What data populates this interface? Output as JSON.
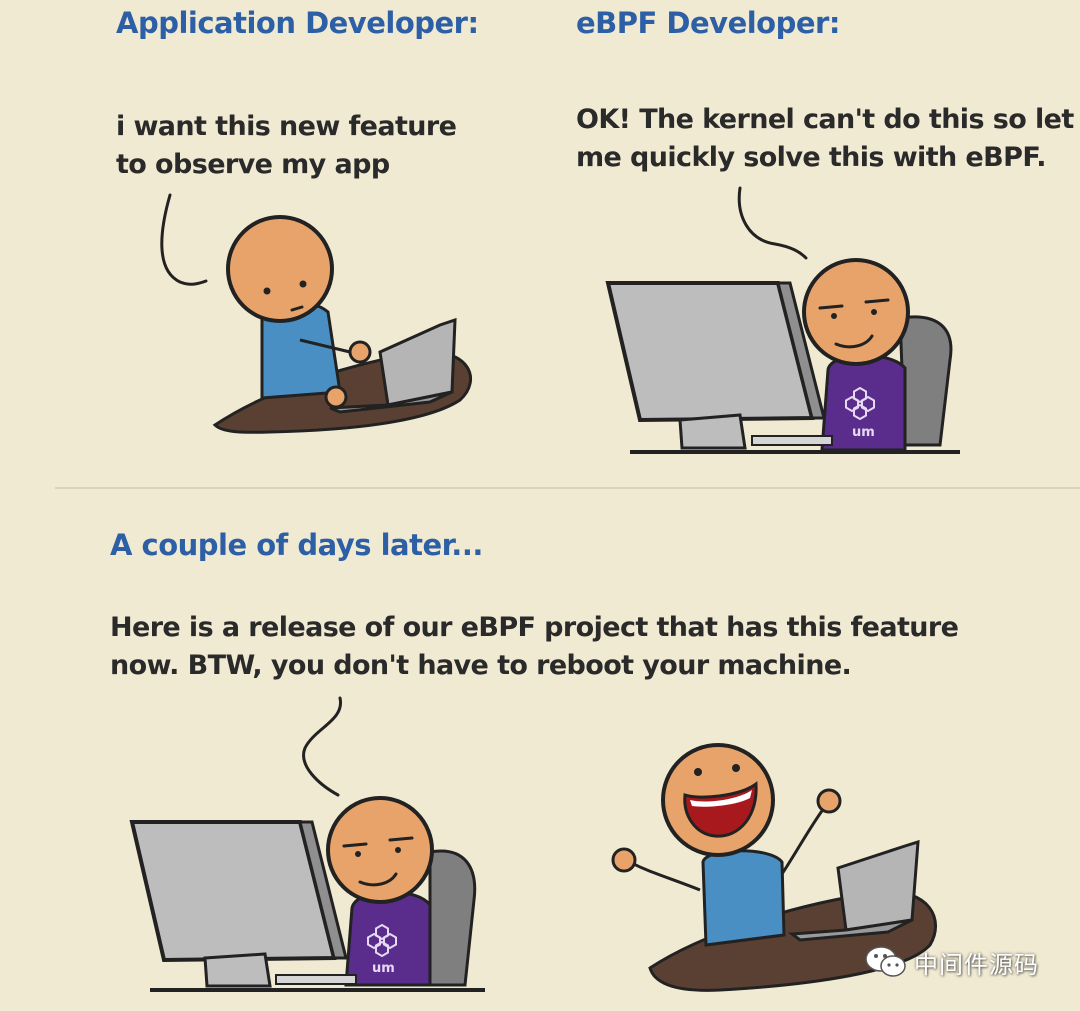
{
  "panels": {
    "app_developer": {
      "heading": "Application Developer:",
      "speech": [
        "i want this new feature",
        "to observe my app"
      ]
    },
    "ebpf_developer": {
      "heading": "eBPF Developer:",
      "speech": [
        "OK! The kernel can't do this so let",
        "me quickly solve this with eBPF."
      ],
      "shirt_logo_text": "um"
    },
    "later": {
      "heading": "A couple of days later...",
      "speech": [
        "Here is a release of our eBPF project that has this feature",
        "now. BTW, you don't have to reboot your machine."
      ],
      "shirt_logo_text": "um"
    }
  },
  "watermark": {
    "text": "中间件源码",
    "icon": "wechat-icon"
  },
  "colors": {
    "background": "#f1ead3",
    "heading": "#2d5fa6",
    "skin": "#e8a36a",
    "shirt_blue": "#4a8fc4",
    "shirt_purple": "#5a2c8c",
    "desk": "#5a4032",
    "monitor": "#bdbdbd"
  }
}
